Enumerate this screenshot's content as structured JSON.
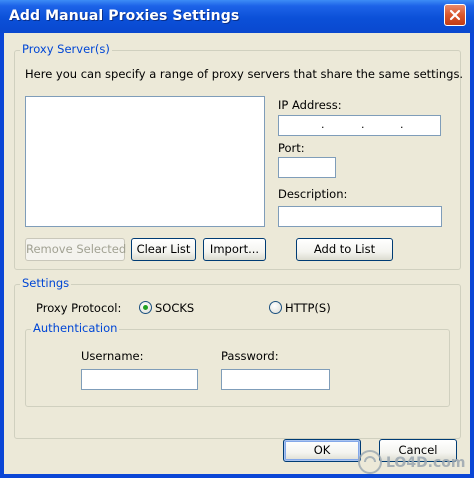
{
  "window": {
    "title": "Add Manual Proxies Settings",
    "close_icon": "close-icon"
  },
  "proxy_servers": {
    "legend": "Proxy Server(s)",
    "description": "Here you can specify a range of proxy servers that share the same settings.",
    "ip_label": "IP Address:",
    "ip_value": ". . .",
    "port_label": "Port:",
    "port_value": "",
    "description_label": "Description:",
    "description_value": "",
    "buttons": {
      "remove_selected": "Remove Selected",
      "clear_list": "Clear List",
      "import": "Import...",
      "add_to_list": "Add to List"
    }
  },
  "settings": {
    "legend": "Settings",
    "protocol_label": "Proxy Protocol:",
    "protocol_options": [
      "SOCKS",
      "HTTP(S)"
    ],
    "protocol_selected": "SOCKS",
    "authentication": {
      "legend": "Authentication",
      "username_label": "Username:",
      "username_value": "",
      "password_label": "Password:",
      "password_value": ""
    }
  },
  "footer": {
    "ok": "OK",
    "cancel": "Cancel"
  },
  "watermark": "LO4D.com",
  "colors": {
    "title_bar": "#0a50d8",
    "dialog_bg": "#ece9d8",
    "group_legend": "#0046d5",
    "radio_selected": "#21a121"
  }
}
